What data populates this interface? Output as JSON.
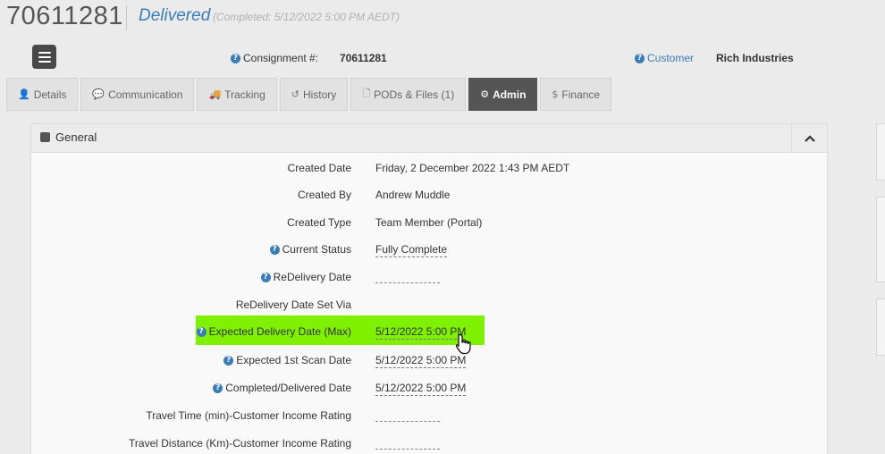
{
  "header": {
    "consignment_number": "70611281",
    "status": "Delivered",
    "status_detail": "(Completed: 5/12/2022 5:00 PM AEDT)"
  },
  "info": {
    "consignment_label": "Consignment #:",
    "consignment_value": "70611281",
    "customer_label": "Customer",
    "customer_value": "Rich Industries"
  },
  "tabs": [
    {
      "label": "Details",
      "icon": "user-icon"
    },
    {
      "label": "Communication",
      "icon": "comment-icon"
    },
    {
      "label": "Tracking",
      "icon": "truck-icon"
    },
    {
      "label": "History",
      "icon": "undo-icon"
    },
    {
      "label": "PODs & Files (1)",
      "icon": "file-icon"
    },
    {
      "label": "Admin",
      "icon": "gear-icon",
      "active": true
    },
    {
      "label": "Finance",
      "icon": "dollar-icon"
    }
  ],
  "panel": {
    "title": "General",
    "fields": [
      {
        "label": "Created Date",
        "value": "Friday, 2 December 2022 1:43 PM AEDT",
        "help": false,
        "editable": false
      },
      {
        "label": "Created By",
        "value": "Andrew Muddle",
        "help": false,
        "editable": false
      },
      {
        "label": "Created Type",
        "value": "Team Member (Portal)",
        "help": false,
        "editable": false
      },
      {
        "label": "Current Status",
        "value": "Fully Complete",
        "help": true,
        "editable": true
      },
      {
        "label": "ReDelivery Date",
        "value": "",
        "help": true,
        "editable": true
      },
      {
        "label": "ReDelivery Date Set Via",
        "value": "",
        "help": false,
        "editable": false
      },
      {
        "label": "Expected Delivery Date (Max)",
        "value": "5/12/2022 5:00 PM",
        "help": true,
        "editable": true
      },
      {
        "label": "Expected 1st Scan Date",
        "value": "5/12/2022 5:00 PM",
        "help": true,
        "editable": true
      },
      {
        "label": "Completed/Delivered Date",
        "value": "5/12/2022 5:00 PM",
        "help": true,
        "editable": true
      },
      {
        "label": "Travel Time (min)-Customer Income Rating",
        "value": "",
        "help": false,
        "editable": true
      },
      {
        "label": "Travel Distance (Km)-Customer Income Rating",
        "value": "",
        "help": false,
        "editable": true
      }
    ]
  },
  "colors": {
    "accent": "#3a7cb8",
    "highlight": "#7ef000",
    "active_tab": "#555555"
  }
}
